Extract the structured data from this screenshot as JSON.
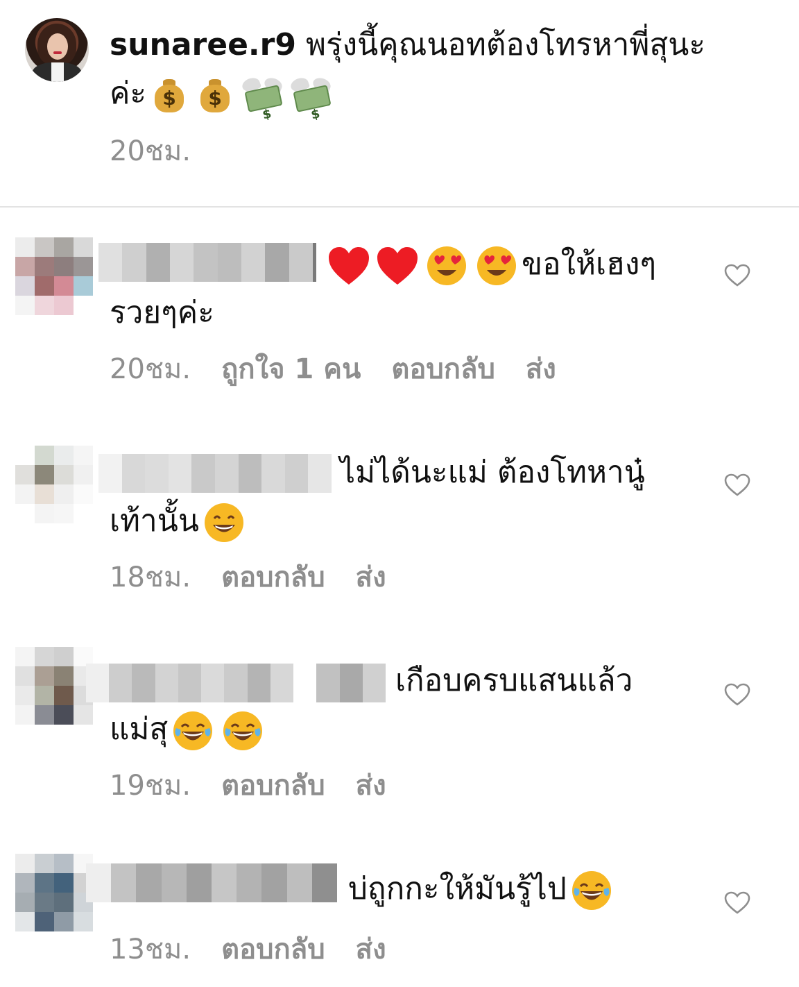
{
  "caption": {
    "username": "sunaree.r9",
    "text_line1": "พรุ่งนี้คุณนอทต้องโทรหาพี่สุนะ",
    "text_line2": "ค่ะ",
    "money_symbol": "$",
    "time": "20ชม."
  },
  "comments": [
    {
      "text_line1": "ขอให้เฮงๆ",
      "text_line2": "รวยๆค่ะ",
      "emojis_before": [
        "red-heart",
        "red-heart",
        "heart-eyes",
        "heart-eyes"
      ],
      "time": "20ชม.",
      "likes": "ถูกใจ 1 คน",
      "reply": "ตอบกลับ",
      "send": "ส่ง"
    },
    {
      "text_line1": "ไม่ได้นะแม่ ต้องโทหานู๋",
      "text_line2": "เท้านั้น",
      "emojis_after": [
        "grinning-face"
      ],
      "time": "18ชม.",
      "reply": "ตอบกลับ",
      "send": "ส่ง"
    },
    {
      "text_line1": "เกือบครบแสนแล้ว",
      "text_line2": "แม่สุ",
      "emojis_after": [
        "tears-of-joy",
        "tears-of-joy"
      ],
      "time": "19ชม.",
      "reply": "ตอบกลับ",
      "send": "ส่ง"
    },
    {
      "text_line1": "บ่ถูกกะให้มันรู้ไป",
      "emojis_after": [
        "tears-of-joy"
      ],
      "time": "13ชม.",
      "reply": "ตอบกลับ",
      "send": "ส่ง"
    }
  ],
  "icons": {
    "like": "heart-outline-icon",
    "heart_color": "#ed1c24",
    "emoji_face_color": "#f7b824"
  },
  "colors": {
    "secondary_text": "#8e8e8e",
    "divider": "#e3e3e3"
  }
}
